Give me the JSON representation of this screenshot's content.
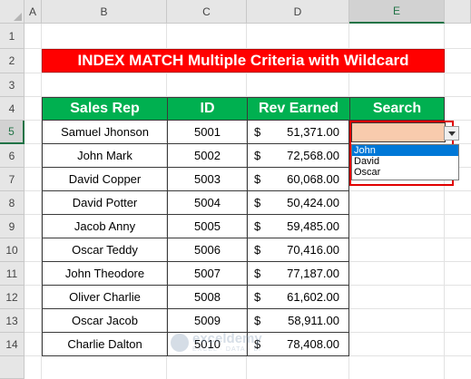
{
  "columns": [
    "A",
    "B",
    "C",
    "D",
    "E"
  ],
  "rows": [
    "1",
    "2",
    "3",
    "4",
    "5",
    "6",
    "7",
    "8",
    "9",
    "10",
    "11",
    "12",
    "13",
    "14"
  ],
  "title": "INDEX MATCH Multiple Criteria with Wildcard",
  "headers": {
    "sales_rep": "Sales Rep",
    "id": "ID",
    "rev": "Rev Earned",
    "search": "Search"
  },
  "records": [
    {
      "name": "Samuel Jhonson",
      "id": "5001",
      "currency": "$",
      "rev": "51,371.00"
    },
    {
      "name": "John Mark",
      "id": "5002",
      "currency": "$",
      "rev": "72,568.00"
    },
    {
      "name": "David Copper",
      "id": "5003",
      "currency": "$",
      "rev": "60,068.00"
    },
    {
      "name": "David Potter",
      "id": "5004",
      "currency": "$",
      "rev": "50,424.00"
    },
    {
      "name": "Jacob Anny",
      "id": "5005",
      "currency": "$",
      "rev": "59,485.00"
    },
    {
      "name": "Oscar Teddy",
      "id": "5006",
      "currency": "$",
      "rev": "70,416.00"
    },
    {
      "name": "John Theodore",
      "id": "5007",
      "currency": "$",
      "rev": "77,187.00"
    },
    {
      "name": "Oliver Charlie",
      "id": "5008",
      "currency": "$",
      "rev": "61,602.00"
    },
    {
      "name": "Oscar Jacob",
      "id": "5009",
      "currency": "$",
      "rev": "58,911.00"
    },
    {
      "name": "Charlie Dalton",
      "id": "5010",
      "currency": "$",
      "rev": "78,408.00"
    }
  ],
  "search": {
    "value": "",
    "options": [
      "John",
      "David",
      "Oscar"
    ],
    "highlighted": "John"
  },
  "watermark": {
    "name": "exceldemy",
    "tagline": "EXCEL · DATA · BI"
  },
  "colors": {
    "title_bg": "#ff0000",
    "header_bg": "#00b050",
    "search_bg": "#f8cbad",
    "highlight": "#0078d7",
    "selected_header": "#217346"
  }
}
